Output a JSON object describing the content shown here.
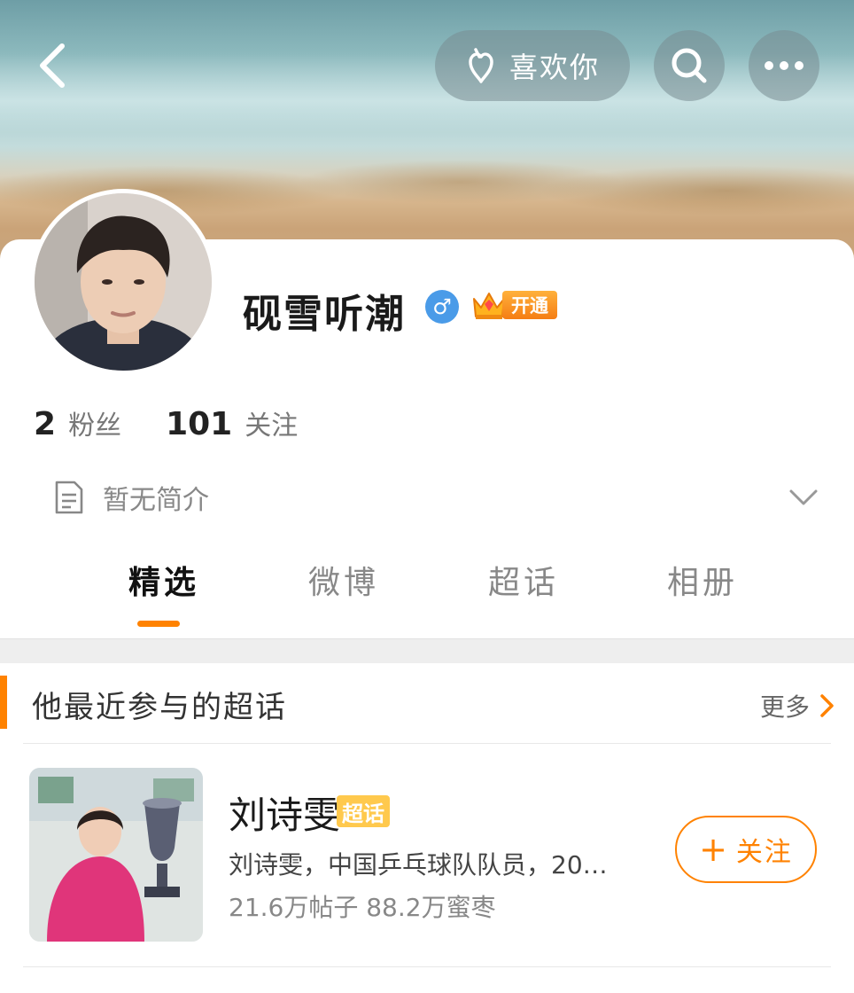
{
  "header": {
    "like_label": "喜欢你"
  },
  "profile": {
    "username": "砚雪听潮",
    "gender_symbol": "♂",
    "vip_label": "开通",
    "followers_count": "2",
    "followers_label": "粉丝",
    "following_count": "101",
    "following_label": "关注",
    "bio": "暂无简介"
  },
  "tabs": [
    {
      "label": "精选",
      "active": true
    },
    {
      "label": "微博",
      "active": false
    },
    {
      "label": "超话",
      "active": false
    },
    {
      "label": "相册",
      "active": false
    }
  ],
  "super_topics": {
    "heading": "他最近参与的超话",
    "more_label": "更多",
    "items": [
      {
        "title": "刘诗雯",
        "tag": "超话",
        "description": "刘诗雯，中国乒乓球队队员，20…",
        "stats": "21.6万帖子 88.2万蜜枣",
        "follow_plus": "+",
        "follow_label": "关注"
      }
    ]
  },
  "colors": {
    "accent": "#ff8200",
    "gender_badge": "#4a9be8",
    "topic_tag": "#ffc94d"
  }
}
